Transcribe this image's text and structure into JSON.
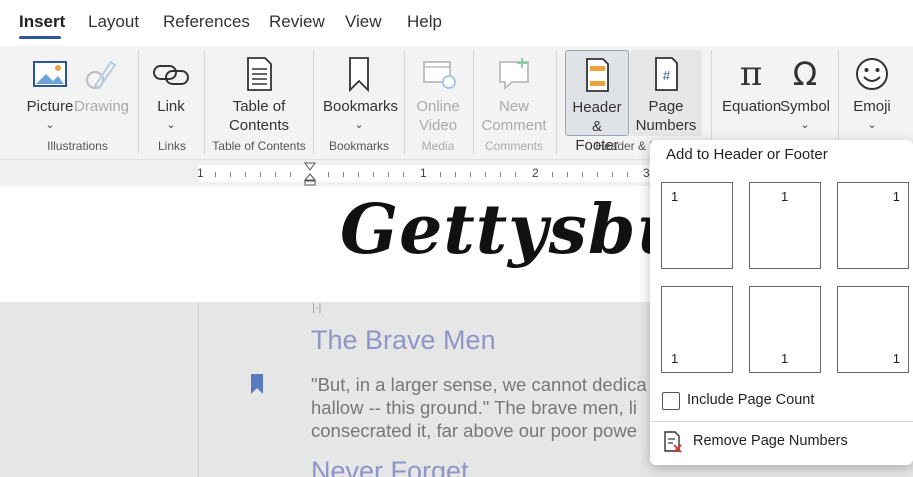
{
  "tabs": [
    "Insert",
    "Layout",
    "References",
    "Review",
    "View",
    "Help"
  ],
  "ribbon": {
    "picture": {
      "line1": "Picture",
      "chevron": "⌄"
    },
    "drawing": {
      "line1": "Drawing"
    },
    "link": {
      "line1": "Link",
      "chevron": "⌄"
    },
    "toc": {
      "line1": "Table of",
      "line2": "Contents"
    },
    "bookmarks": {
      "line1": "Bookmarks",
      "chevron": "⌄"
    },
    "online_video": {
      "line1": "Online",
      "line2": "Video"
    },
    "new_comment": {
      "line1": "New",
      "line2": "Comment"
    },
    "header_footer": {
      "line1": "Header &",
      "line2": "Footer"
    },
    "page_numbers": {
      "line1": "Page",
      "line2": "Numbers ⌄"
    },
    "equation": {
      "line1": "Equation"
    },
    "symbol": {
      "line1": "Symbol",
      "chevron": "⌄"
    },
    "emoji": {
      "line1": "Emoji",
      "chevron": "⌄"
    },
    "groups": {
      "illustrations": "Illustrations",
      "links": "Links",
      "toc": "Table of Contents",
      "bookmarks": "Bookmarks",
      "media": "Media",
      "comments": "Comments",
      "header_footer": "Header & F"
    }
  },
  "ruler": {
    "marks": [
      "1",
      "1",
      "2",
      "3"
    ]
  },
  "document": {
    "title": "Gettysbur",
    "heading1": "The Brave Men",
    "paragraph": [
      "\"But, in a larger sense, we cannot dedica",
      "hallow -- this ground.\" The brave men, li",
      "consecrated it, far above our poor powe"
    ],
    "heading2": "Never Forget"
  },
  "dropdown": {
    "title": "Add to Header or Footer",
    "thumbnails": [
      "1",
      "1",
      "1",
      "1",
      "1",
      "1"
    ],
    "include_page_count": "Include Page Count",
    "remove_page_numbers": "Remove Page Numbers"
  },
  "colors": {
    "accent": "#2b579a",
    "heading": "#8f95c8",
    "bookmark": "#5a7bc0"
  }
}
